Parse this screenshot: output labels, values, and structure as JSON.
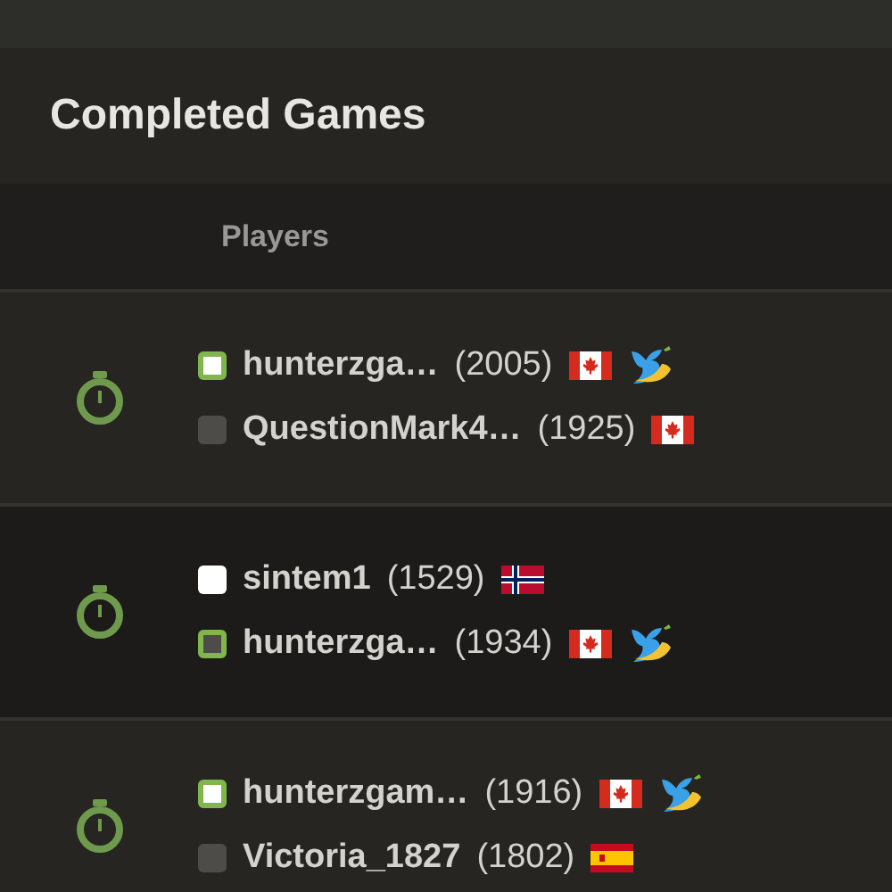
{
  "title": "Completed Games",
  "columns": [
    "Players"
  ],
  "games": [
    {
      "players": [
        {
          "color": "#ffffff",
          "winner": true,
          "name": "hunterzga…",
          "rating": "(2005)",
          "kind": "canada",
          "supporter": true
        },
        {
          "color": "#4d4c49",
          "winner": false,
          "name": "QuestionMark4…",
          "rating": "(1925)",
          "kind": "canada",
          "supporter": false
        }
      ]
    },
    {
      "players": [
        {
          "color": "#ffffff",
          "winner": false,
          "name": "sintem1",
          "rating": "(1529)",
          "kind": "norway",
          "supporter": false
        },
        {
          "color": "#4d4c49",
          "winner": true,
          "name": "hunterzga…",
          "rating": "(1934)",
          "kind": "canada",
          "supporter": true
        }
      ]
    },
    {
      "players": [
        {
          "color": "#ffffff",
          "winner": true,
          "name": "hunterzgam…",
          "rating": "(1916)",
          "kind": "canada",
          "supporter": true
        },
        {
          "color": "#4d4c49",
          "winner": false,
          "name": "Victoria_1827",
          "rating": "(1802)",
          "kind": "spain",
          "supporter": false
        }
      ]
    }
  ]
}
